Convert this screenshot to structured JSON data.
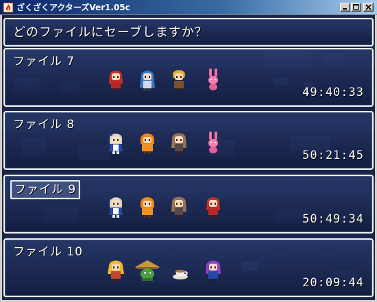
{
  "window": {
    "title": "ざくざくアクターズVer1.05c",
    "icon": "app-flame-icon",
    "controls": [
      "minimize-icon",
      "maximize-icon",
      "close-icon"
    ]
  },
  "screen": {
    "prompt": "どのファイルにセーブしますか？",
    "selected_index": 2,
    "slots": [
      {
        "label": "ファイル 7",
        "play_time": "49:40:33",
        "party": [
          "red-haired-girl-sprite",
          "blue-haired-girl-sprite",
          "blonde-boy-sprite",
          "pink-rabbit-sprite"
        ]
      },
      {
        "label": "ファイル 8",
        "play_time": "50:21:45",
        "party": [
          "silver-haired-maid-sprite",
          "orange-hooded-girl-sprite",
          "brown-haired-girl-sprite",
          "pink-rabbit-sprite"
        ]
      },
      {
        "label": "ファイル 9",
        "play_time": "50:49:34",
        "party": [
          "silver-haired-maid-sprite",
          "orange-hooded-girl-sprite",
          "brown-haired-girl-sprite",
          "red-haired-girl-sprite"
        ]
      },
      {
        "label": "ファイル 10",
        "play_time": "20:09:44",
        "party": [
          "blonde-girl-sprite",
          "green-hat-creature-sprite",
          "teacup-sprite",
          "purple-haired-girl-sprite"
        ]
      }
    ]
  },
  "colors": {
    "window_border": "#eef2fa",
    "window_fill": "#1f2e5c",
    "text": "#ffffff"
  }
}
